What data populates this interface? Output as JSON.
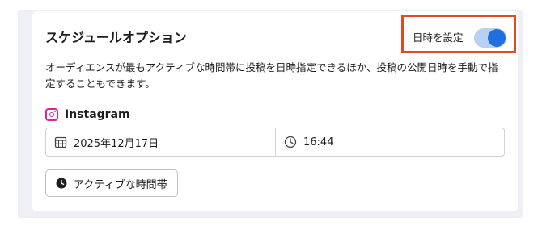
{
  "schedule": {
    "title": "スケジュールオプション",
    "toggle_label": "日時を設定",
    "toggle_on": true,
    "description": "オーディエンスが最もアクティブな時間帯に投稿を日時指定できるほか、投稿の公開日時を手動で指定することもできます。",
    "platform": {
      "name": "Instagram",
      "icon": "instagram-icon"
    },
    "date": {
      "value": "2025年12月17日",
      "icon": "calendar-icon"
    },
    "time": {
      "value": "16:44",
      "icon": "clock-icon"
    },
    "active_times_button": {
      "label": "アクティブな時間帯",
      "icon": "clock-filled-icon"
    }
  },
  "colors": {
    "toggle_track": "#b9d0f5",
    "toggle_knob": "#1f6fe0",
    "highlight_border": "#e24a22",
    "instagram": "#d6249f"
  }
}
